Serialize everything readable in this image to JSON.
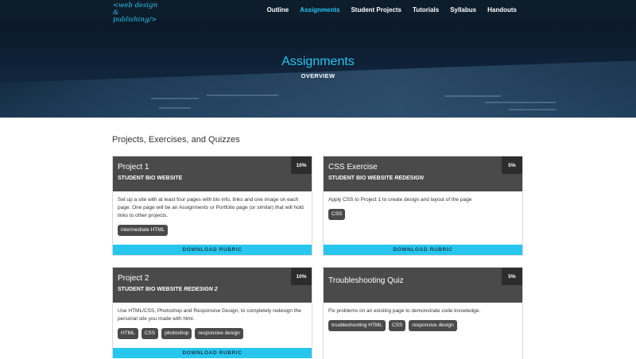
{
  "logo": {
    "line1": "<web design",
    "line2": "& publishing/>"
  },
  "nav": {
    "items": [
      {
        "label": "Outline"
      },
      {
        "label": "Assignments"
      },
      {
        "label": "Student Projects"
      },
      {
        "label": "Tutorials"
      },
      {
        "label": "Syllabus"
      },
      {
        "label": "Handouts"
      }
    ],
    "active": "Assignments"
  },
  "hero": {
    "title": "Assignments",
    "subtitle": "OVERVIEW"
  },
  "section_title": "Projects, Exercises, and Quizzes",
  "cards": [
    {
      "title": "Project 1",
      "subtitle_main": "STUDENT BIO WEBSITE",
      "subtitle_em": "",
      "percent": "10%",
      "description": "Set up a site with at least four pages with bio info, links and one image on each page. One page will be an Assignments or Portfolio page (or similar) that will hold links to other projects.",
      "tags": [
        "intermediate HTML"
      ],
      "button": "DOWNLOAD RUBRIC"
    },
    {
      "title": "CSS Exercise",
      "subtitle_main": "STUDENT BIO WEBSITE",
      "subtitle_em": "REDESIGN",
      "percent": "5%",
      "description": "Apply CSS to Project 1 to create design and layout of the page",
      "tags": [
        "CSS"
      ],
      "button": "DOWNLOAD RUBRIC"
    },
    {
      "title": "Project 2",
      "subtitle_main": "STUDENT BIO WEBSITE",
      "subtitle_em": "REDESIGN 2",
      "percent": "10%",
      "description": "Use HTML/CSS, Photoshop and Responsive Design, to completely redesign the personal site you made with html.",
      "tags": [
        "HTML",
        "CSS",
        "photoshop",
        "responsive design"
      ],
      "button": "DOWNLOAD RUBRIC"
    },
    {
      "title": "Troubleshooting Quiz",
      "subtitle_main": "",
      "subtitle_em": "",
      "percent": "5%",
      "description": "Fix problems on an existing page to demonstrate code knowledge.",
      "tags": [
        "troubleshooting HTML",
        "CSS",
        "responsive design"
      ],
      "button": ""
    }
  ],
  "colors": {
    "accent": "#27c6ef",
    "navbar": "#0e1d2c",
    "card_head": "#4a4a4a"
  }
}
